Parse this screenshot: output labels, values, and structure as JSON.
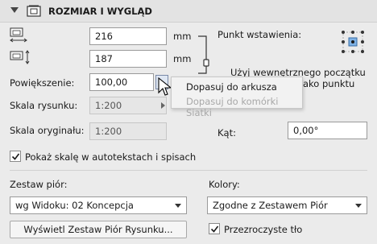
{
  "header": {
    "title": "ROZMIAR I WYGLĄD"
  },
  "size": {
    "width_value": "216",
    "height_value": "187",
    "unit": "mm"
  },
  "scale": {
    "zoom_label": "Powiększenie:",
    "zoom_value": "100,00",
    "drawing_scale_label": "Skala rysunku:",
    "drawing_scale_value": "1:200",
    "original_scale_label": "Skala oryginału:",
    "original_scale_value": "1:200"
  },
  "insertion": {
    "label": "Punkt wstawienia:",
    "hidden_text_line1": "Użyj wewnętrznego początku",
    "hidden_text_line2": "ako punktu"
  },
  "angle": {
    "label": "Kąt:",
    "value": "0,00°"
  },
  "show_scale": {
    "label": "Pokaż skalę w autotekstach i spisach",
    "checked": true
  },
  "pen_set": {
    "label": "Zestaw piór:",
    "value": "wg Widoku: 02 Koncepcja",
    "button_label": "Wyświetl Zestaw Piór Rysunku..."
  },
  "colors": {
    "label": "Kolory:",
    "value": "Zgodne z Zestawem Piór",
    "transparent_label": "Przezroczyste tło",
    "transparent_checked": true
  },
  "menu": {
    "item1": "Dopasuj do arkusza",
    "item2": "Dopasuj do komórki Siatki"
  }
}
